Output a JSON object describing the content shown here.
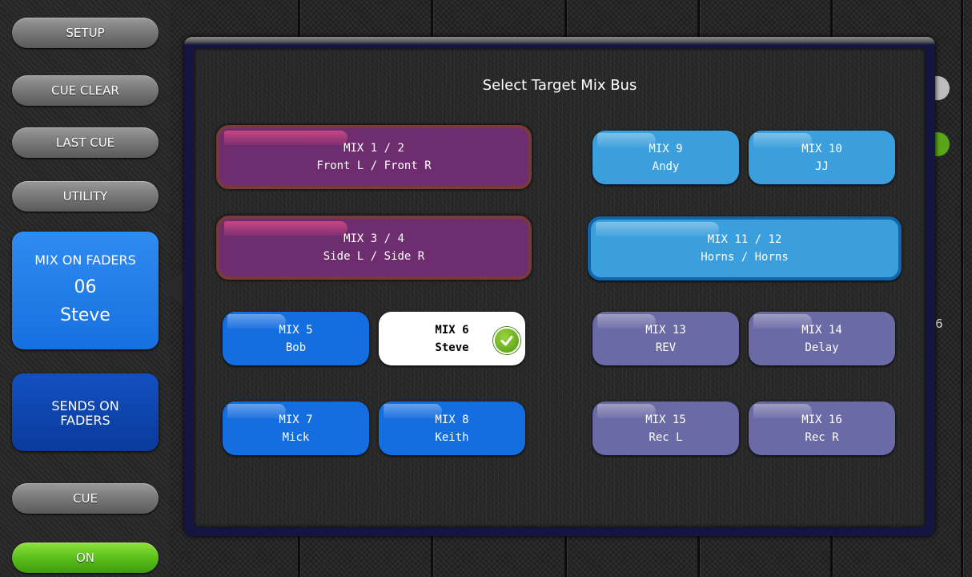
{
  "sidebar": {
    "setup": "SETUP",
    "cue_clear": "CUE CLEAR",
    "last_cue": "LAST CUE",
    "utility": "UTILITY",
    "mix_on_faders": {
      "label": "MIX ON FADERS",
      "number": "06",
      "name": "Steve"
    },
    "sends_on_faders": {
      "line1": "SENDS ON",
      "line2": "FADERS"
    },
    "cue": "CUE",
    "on": "ON"
  },
  "dialog": {
    "title": "Select Target Mix Bus",
    "buses": [
      {
        "id": "mix-1-2",
        "line1": "MIX 1 / 2",
        "line2": "Front L / Front R"
      },
      {
        "id": "mix-3-4",
        "line1": "MIX 3 / 4",
        "line2": "Side L / Side R"
      },
      {
        "id": "mix-5",
        "line1": "MIX 5",
        "line2": "Bob"
      },
      {
        "id": "mix-6",
        "line1": "MIX 6",
        "line2": "Steve",
        "selected": true
      },
      {
        "id": "mix-7",
        "line1": "MIX 7",
        "line2": "Mick"
      },
      {
        "id": "mix-8",
        "line1": "MIX 8",
        "line2": "Keith"
      },
      {
        "id": "mix-9",
        "line1": "MIX 9",
        "line2": "Andy"
      },
      {
        "id": "mix-10",
        "line1": "MIX 10",
        "line2": "JJ"
      },
      {
        "id": "mix-11-12",
        "line1": "MIX 11 / 12",
        "line2": "Horns / Horns"
      },
      {
        "id": "mix-13",
        "line1": "MIX 13",
        "line2": "REV"
      },
      {
        "id": "mix-14",
        "line1": "MIX 14",
        "line2": "Delay"
      },
      {
        "id": "mix-15",
        "line1": "MIX 15",
        "line2": "Rec L"
      },
      {
        "id": "mix-16",
        "line1": "MIX 16",
        "line2": "Rec R"
      }
    ]
  },
  "background": {
    "edge_label": "6"
  },
  "colors": {
    "stereo_bus": "#6e2d6e",
    "aux_bus": "#156ee0",
    "light_bus": "#3a9fdc",
    "fx_bus": "#6a6aa6",
    "selected": "#ffffff",
    "check": "#5bb01a"
  },
  "icons": {
    "selected_indicator": "checkmark-icon"
  }
}
